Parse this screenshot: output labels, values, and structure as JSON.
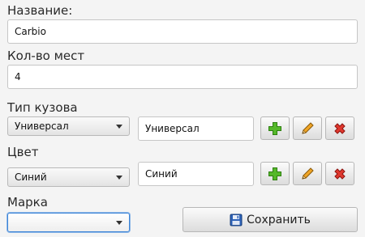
{
  "form": {
    "name_label": "Название:",
    "name_value": "Carbio",
    "seats_label": "Кол-во мест",
    "seats_value": "4",
    "body_label": "Тип кузова",
    "body_combo_value": "Универсал",
    "body_field_value": "Универсал",
    "color_label": "Цвет",
    "color_combo_value": "Синий",
    "color_field_value": "Синий",
    "brand_label": "Марка",
    "brand_combo_value": "",
    "save_label": "Сохранить"
  },
  "icons": {
    "add": "plus-icon",
    "edit": "pencil-icon",
    "delete": "delete-x-icon",
    "save": "floppy-disk-icon"
  },
  "colors": {
    "add_green": "#4caf1f",
    "delete_red": "#d8322a",
    "pencil_orange": "#e89a1c",
    "focus_blue": "#3b83d6",
    "save_blue": "#2e63b8"
  }
}
